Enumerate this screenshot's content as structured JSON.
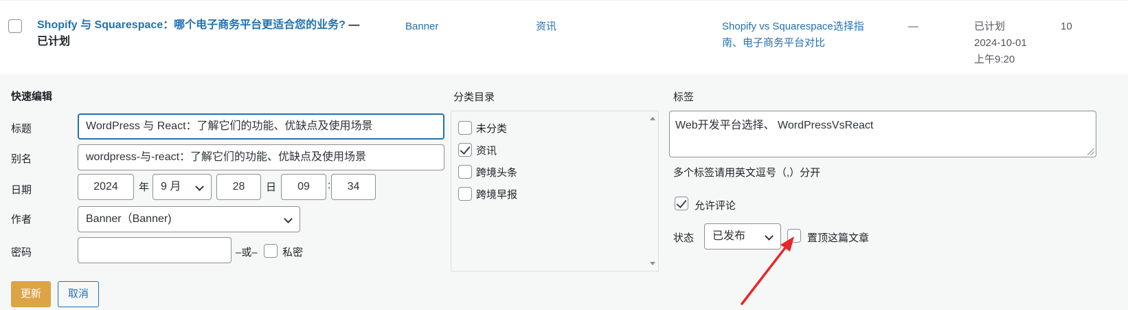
{
  "post_row": {
    "title": "Shopify 与 Squarespace：哪个电子商务平台更适合您的业务?",
    "dash": "—",
    "state": "已计划",
    "author": "Banner",
    "category": "资讯",
    "tags": "Shopify vs Squarespace选择指南、电子商务平台对比",
    "comments_dash": "—",
    "date_status": "已计划",
    "date": "2024-10-01",
    "time": "上午9:20",
    "count": "10"
  },
  "quick_edit": {
    "heading": "快速编辑",
    "title_label": "标题",
    "title_value": "WordPress 与 React：了解它们的功能、优缺点及使用场景",
    "slug_label": "别名",
    "slug_value": "wordpress-与-react：了解它们的功能、优缺点及使用场景",
    "date_label": "日期",
    "year": "2024",
    "year_unit": "年",
    "month": "9 月",
    "day": "28",
    "day_unit": "日",
    "hour": "09",
    "colon": ":",
    "minute": "34",
    "author_label": "作者",
    "author_value": "Banner（Banner)",
    "password_label": "密码",
    "password_value": "",
    "or_text": "–或–",
    "private_label": "私密",
    "update_button": "更新",
    "cancel_button": "取消"
  },
  "categories": {
    "label": "分类目录",
    "items": [
      {
        "label": "未分类",
        "checked": false
      },
      {
        "label": "资讯",
        "checked": true
      },
      {
        "label": "跨境头条",
        "checked": false
      },
      {
        "label": "跨境早报",
        "checked": false
      }
    ]
  },
  "tags_panel": {
    "label": "标签",
    "value": "Web开发平台选择、 WordPressVsReact",
    "hint": "多个标签请用英文逗号（,）分开",
    "allow_comments": "允许评论",
    "status_label": "状态",
    "status_value": "已发布",
    "sticky_label": "置顶这篇文章"
  },
  "colors": {
    "link": "#2271b1",
    "primary_button": "#dda445",
    "annotation_arrow": "#e8262a"
  }
}
